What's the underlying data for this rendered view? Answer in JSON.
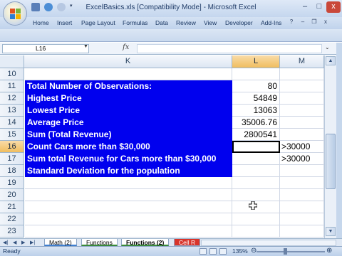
{
  "window": {
    "title": "ExcelBasics.xls  [Compatibility Mode] - Microsoft Excel",
    "minimize_icon": "minimize-icon",
    "maximize_icon": "maximize-icon",
    "close_icon": "close-icon",
    "close_glyph": "x",
    "minimize_glyph": "–",
    "maximize_glyph": "□"
  },
  "ribbon_tabs": [
    "Home",
    "Insert",
    "Page Layout",
    "Formulas",
    "Data",
    "Review",
    "View",
    "Developer",
    "Add-Ins"
  ],
  "formula_bar": {
    "name_box": "L16",
    "fx_label": "fx",
    "formula": ""
  },
  "columns": [
    "K",
    "L",
    "M"
  ],
  "selected_column": "L",
  "rows": [
    {
      "num": "10",
      "k": "",
      "l": "",
      "m": "",
      "blue": false
    },
    {
      "num": "11",
      "k": "Total Number of Observations:",
      "l": "80",
      "m": "",
      "blue": true
    },
    {
      "num": "12",
      "k": "Highest Price",
      "l": "54849",
      "m": "",
      "blue": true
    },
    {
      "num": "13",
      "k": "Lowest Price",
      "l": "13063",
      "m": "",
      "blue": true
    },
    {
      "num": "14",
      "k": "Average Price",
      "l": "35006.76",
      "m": "",
      "blue": true
    },
    {
      "num": "15",
      "k": "Sum (Total Revenue)",
      "l": "2800541",
      "m": "",
      "blue": true
    },
    {
      "num": "16",
      "k": "Count Cars more than $30,000",
      "l": "",
      "m": ">30000",
      "blue": true
    },
    {
      "num": "17",
      "k": "Sum total Revenue for Cars more than $30,000",
      "l": "",
      "m": ">30000",
      "blue": true
    },
    {
      "num": "18",
      "k": "Standard Deviation for the population",
      "l": "",
      "m": "",
      "blue": true
    },
    {
      "num": "19",
      "k": "",
      "l": "",
      "m": "",
      "blue": false
    },
    {
      "num": "20",
      "k": "",
      "l": "",
      "m": "",
      "blue": false
    },
    {
      "num": "21",
      "k": "",
      "l": "",
      "m": "",
      "blue": false
    },
    {
      "num": "22",
      "k": "",
      "l": "",
      "m": "",
      "blue": false
    },
    {
      "num": "23",
      "k": "",
      "l": "",
      "m": "",
      "blue": false
    }
  ],
  "selected_row": "16",
  "sheet_tabs": [
    "Math (2)",
    "Functions",
    "Functions (2)",
    "Cell R"
  ],
  "active_sheet": "Functions (2)",
  "status": {
    "mode": "Ready",
    "zoom": "135%"
  },
  "colors": {
    "label_fill": "#0000ee",
    "label_text": "#ffffff",
    "selection_header": "#f0bd5f"
  }
}
